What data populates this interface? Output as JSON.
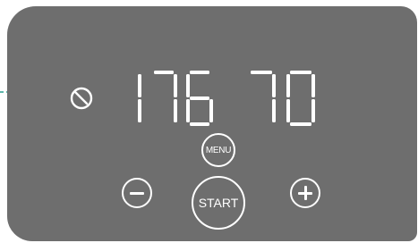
{
  "display": {
    "left_digits": "176",
    "right_digits": "70"
  },
  "buttons": {
    "menu_label": "MENU",
    "start_label": "START",
    "minus_icon": "minus-icon",
    "plus_icon": "plus-icon"
  },
  "indicator": {
    "icon": "clock-off-icon",
    "pointer_color": "#2a9d8f"
  },
  "colors": {
    "panel": "#6e6e6e",
    "foreground": "#ffffff",
    "background": "#ffffff"
  }
}
